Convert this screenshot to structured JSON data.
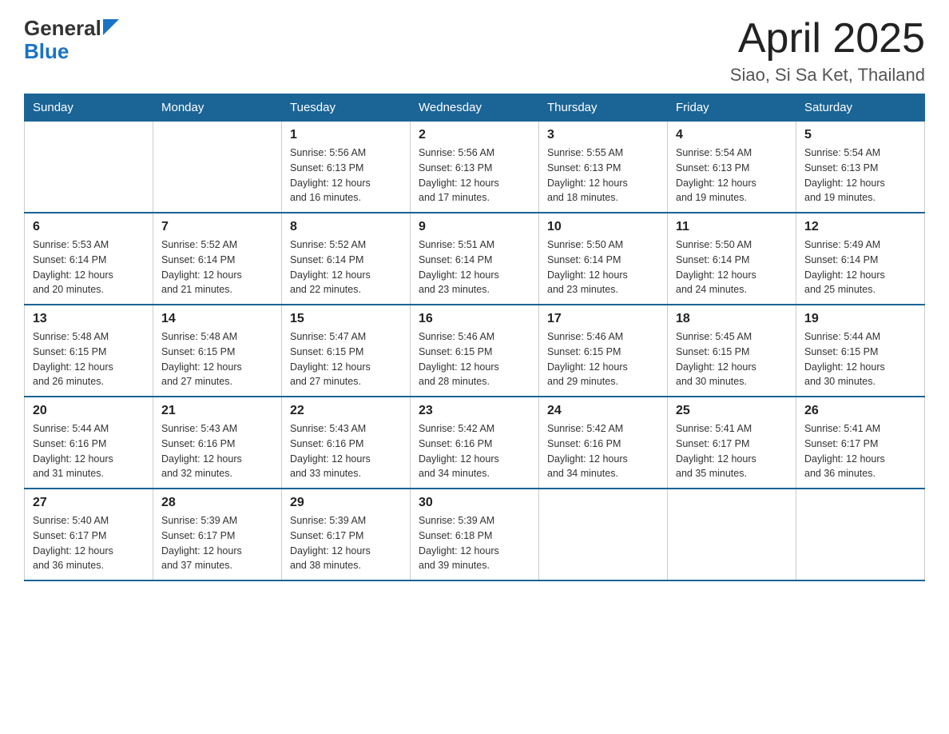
{
  "header": {
    "logo_general": "General",
    "logo_blue": "Blue",
    "month_title": "April 2025",
    "location": "Siao, Si Sa Ket, Thailand"
  },
  "days_of_week": [
    "Sunday",
    "Monday",
    "Tuesday",
    "Wednesday",
    "Thursday",
    "Friday",
    "Saturday"
  ],
  "weeks": [
    [
      {
        "day": "",
        "info": ""
      },
      {
        "day": "",
        "info": ""
      },
      {
        "day": "1",
        "info": "Sunrise: 5:56 AM\nSunset: 6:13 PM\nDaylight: 12 hours\nand 16 minutes."
      },
      {
        "day": "2",
        "info": "Sunrise: 5:56 AM\nSunset: 6:13 PM\nDaylight: 12 hours\nand 17 minutes."
      },
      {
        "day": "3",
        "info": "Sunrise: 5:55 AM\nSunset: 6:13 PM\nDaylight: 12 hours\nand 18 minutes."
      },
      {
        "day": "4",
        "info": "Sunrise: 5:54 AM\nSunset: 6:13 PM\nDaylight: 12 hours\nand 19 minutes."
      },
      {
        "day": "5",
        "info": "Sunrise: 5:54 AM\nSunset: 6:13 PM\nDaylight: 12 hours\nand 19 minutes."
      }
    ],
    [
      {
        "day": "6",
        "info": "Sunrise: 5:53 AM\nSunset: 6:14 PM\nDaylight: 12 hours\nand 20 minutes."
      },
      {
        "day": "7",
        "info": "Sunrise: 5:52 AM\nSunset: 6:14 PM\nDaylight: 12 hours\nand 21 minutes."
      },
      {
        "day": "8",
        "info": "Sunrise: 5:52 AM\nSunset: 6:14 PM\nDaylight: 12 hours\nand 22 minutes."
      },
      {
        "day": "9",
        "info": "Sunrise: 5:51 AM\nSunset: 6:14 PM\nDaylight: 12 hours\nand 23 minutes."
      },
      {
        "day": "10",
        "info": "Sunrise: 5:50 AM\nSunset: 6:14 PM\nDaylight: 12 hours\nand 23 minutes."
      },
      {
        "day": "11",
        "info": "Sunrise: 5:50 AM\nSunset: 6:14 PM\nDaylight: 12 hours\nand 24 minutes."
      },
      {
        "day": "12",
        "info": "Sunrise: 5:49 AM\nSunset: 6:14 PM\nDaylight: 12 hours\nand 25 minutes."
      }
    ],
    [
      {
        "day": "13",
        "info": "Sunrise: 5:48 AM\nSunset: 6:15 PM\nDaylight: 12 hours\nand 26 minutes."
      },
      {
        "day": "14",
        "info": "Sunrise: 5:48 AM\nSunset: 6:15 PM\nDaylight: 12 hours\nand 27 minutes."
      },
      {
        "day": "15",
        "info": "Sunrise: 5:47 AM\nSunset: 6:15 PM\nDaylight: 12 hours\nand 27 minutes."
      },
      {
        "day": "16",
        "info": "Sunrise: 5:46 AM\nSunset: 6:15 PM\nDaylight: 12 hours\nand 28 minutes."
      },
      {
        "day": "17",
        "info": "Sunrise: 5:46 AM\nSunset: 6:15 PM\nDaylight: 12 hours\nand 29 minutes."
      },
      {
        "day": "18",
        "info": "Sunrise: 5:45 AM\nSunset: 6:15 PM\nDaylight: 12 hours\nand 30 minutes."
      },
      {
        "day": "19",
        "info": "Sunrise: 5:44 AM\nSunset: 6:15 PM\nDaylight: 12 hours\nand 30 minutes."
      }
    ],
    [
      {
        "day": "20",
        "info": "Sunrise: 5:44 AM\nSunset: 6:16 PM\nDaylight: 12 hours\nand 31 minutes."
      },
      {
        "day": "21",
        "info": "Sunrise: 5:43 AM\nSunset: 6:16 PM\nDaylight: 12 hours\nand 32 minutes."
      },
      {
        "day": "22",
        "info": "Sunrise: 5:43 AM\nSunset: 6:16 PM\nDaylight: 12 hours\nand 33 minutes."
      },
      {
        "day": "23",
        "info": "Sunrise: 5:42 AM\nSunset: 6:16 PM\nDaylight: 12 hours\nand 34 minutes."
      },
      {
        "day": "24",
        "info": "Sunrise: 5:42 AM\nSunset: 6:16 PM\nDaylight: 12 hours\nand 34 minutes."
      },
      {
        "day": "25",
        "info": "Sunrise: 5:41 AM\nSunset: 6:17 PM\nDaylight: 12 hours\nand 35 minutes."
      },
      {
        "day": "26",
        "info": "Sunrise: 5:41 AM\nSunset: 6:17 PM\nDaylight: 12 hours\nand 36 minutes."
      }
    ],
    [
      {
        "day": "27",
        "info": "Sunrise: 5:40 AM\nSunset: 6:17 PM\nDaylight: 12 hours\nand 36 minutes."
      },
      {
        "day": "28",
        "info": "Sunrise: 5:39 AM\nSunset: 6:17 PM\nDaylight: 12 hours\nand 37 minutes."
      },
      {
        "day": "29",
        "info": "Sunrise: 5:39 AM\nSunset: 6:17 PM\nDaylight: 12 hours\nand 38 minutes."
      },
      {
        "day": "30",
        "info": "Sunrise: 5:39 AM\nSunset: 6:18 PM\nDaylight: 12 hours\nand 39 minutes."
      },
      {
        "day": "",
        "info": ""
      },
      {
        "day": "",
        "info": ""
      },
      {
        "day": "",
        "info": ""
      }
    ]
  ]
}
